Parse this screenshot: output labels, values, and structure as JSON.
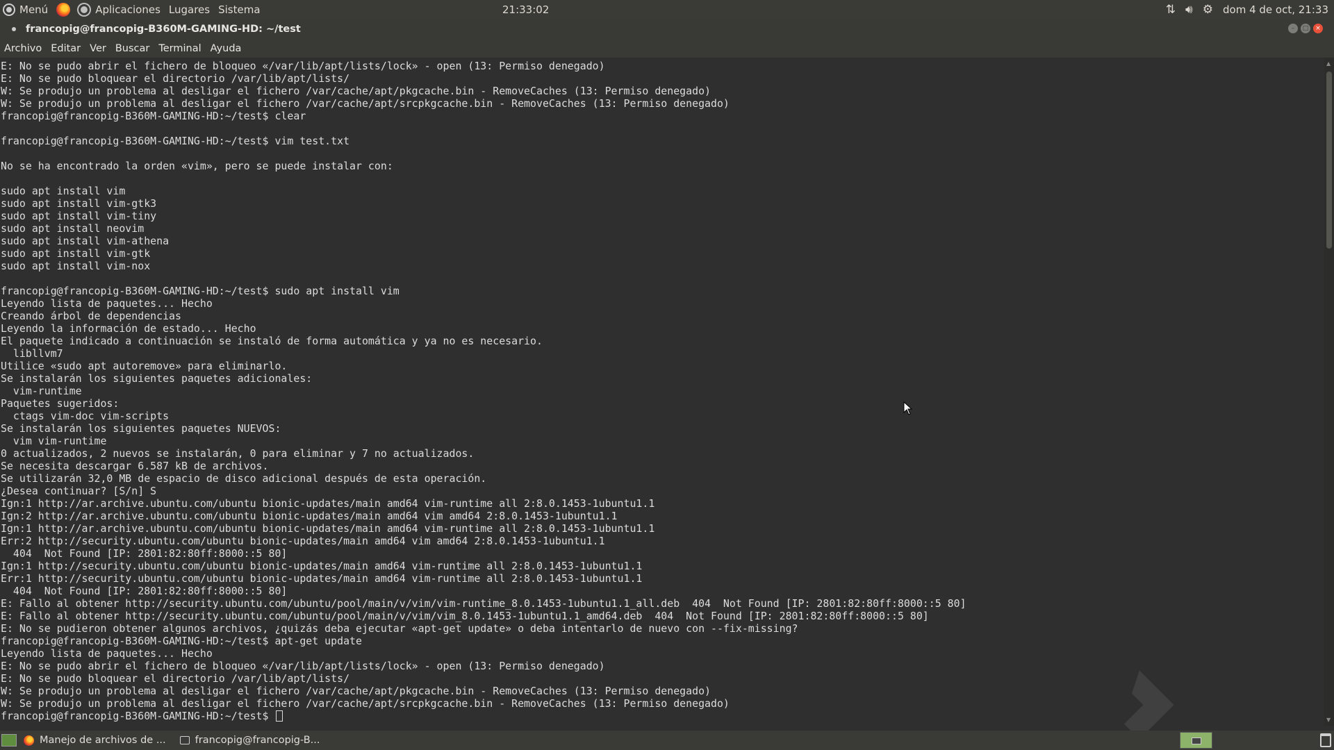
{
  "top_panel": {
    "menu_label": "Menú",
    "applications_label": "Aplicaciones",
    "places_label": "Lugares",
    "system_label": "Sistema",
    "clock": "21:33:02",
    "date": "dom  4 de oct, 21:33"
  },
  "window": {
    "title": "francopig@francopig-B360M-GAMING-HD: ~/test"
  },
  "menubar": {
    "file": "Archivo",
    "edit": "Editar",
    "view": "Ver",
    "search": "Buscar",
    "terminal": "Terminal",
    "help": "Ayuda"
  },
  "terminal": {
    "lines": [
      "E: No se pudo abrir el fichero de bloqueo «/var/lib/apt/lists/lock» - open (13: Permiso denegado)",
      "E: No se pudo bloquear el directorio /var/lib/apt/lists/",
      "W: Se produjo un problema al desligar el fichero /var/cache/apt/pkgcache.bin - RemoveCaches (13: Permiso denegado)",
      "W: Se produjo un problema al desligar el fichero /var/cache/apt/srcpkgcache.bin - RemoveCaches (13: Permiso denegado)",
      "francopig@francopig-B360M-GAMING-HD:~/test$ clear",
      "",
      "francopig@francopig-B360M-GAMING-HD:~/test$ vim test.txt",
      "",
      "No se ha encontrado la orden «vim», pero se puede instalar con:",
      "",
      "sudo apt install vim",
      "sudo apt install vim-gtk3",
      "sudo apt install vim-tiny",
      "sudo apt install neovim",
      "sudo apt install vim-athena",
      "sudo apt install vim-gtk",
      "sudo apt install vim-nox",
      "",
      "francopig@francopig-B360M-GAMING-HD:~/test$ sudo apt install vim",
      "Leyendo lista de paquetes... Hecho",
      "Creando árbol de dependencias",
      "Leyendo la información de estado... Hecho",
      "El paquete indicado a continuación se instaló de forma automática y ya no es necesario.",
      "  libllvm7",
      "Utilice «sudo apt autoremove» para eliminarlo.",
      "Se instalarán los siguientes paquetes adicionales:",
      "  vim-runtime",
      "Paquetes sugeridos:",
      "  ctags vim-doc vim-scripts",
      "Se instalarán los siguientes paquetes NUEVOS:",
      "  vim vim-runtime",
      "0 actualizados, 2 nuevos se instalarán, 0 para eliminar y 7 no actualizados.",
      "Se necesita descargar 6.587 kB de archivos.",
      "Se utilizarán 32,0 MB de espacio de disco adicional después de esta operación.",
      "¿Desea continuar? [S/n] S",
      "Ign:1 http://ar.archive.ubuntu.com/ubuntu bionic-updates/main amd64 vim-runtime all 2:8.0.1453-1ubuntu1.1",
      "Ign:2 http://ar.archive.ubuntu.com/ubuntu bionic-updates/main amd64 vim amd64 2:8.0.1453-1ubuntu1.1",
      "Ign:1 http://ar.archive.ubuntu.com/ubuntu bionic-updates/main amd64 vim-runtime all 2:8.0.1453-1ubuntu1.1",
      "Err:2 http://security.ubuntu.com/ubuntu bionic-updates/main amd64 vim amd64 2:8.0.1453-1ubuntu1.1",
      "  404  Not Found [IP: 2801:82:80ff:8000::5 80]",
      "Ign:1 http://security.ubuntu.com/ubuntu bionic-updates/main amd64 vim-runtime all 2:8.0.1453-1ubuntu1.1",
      "Err:1 http://security.ubuntu.com/ubuntu bionic-updates/main amd64 vim-runtime all 2:8.0.1453-1ubuntu1.1",
      "  404  Not Found [IP: 2801:82:80ff:8000::5 80]",
      "E: Fallo al obtener http://security.ubuntu.com/ubuntu/pool/main/v/vim/vim-runtime_8.0.1453-1ubuntu1.1_all.deb  404  Not Found [IP: 2801:82:80ff:8000::5 80]",
      "E: Fallo al obtener http://security.ubuntu.com/ubuntu/pool/main/v/vim/vim_8.0.1453-1ubuntu1.1_amd64.deb  404  Not Found [IP: 2801:82:80ff:8000::5 80]",
      "E: No se pudieron obtener algunos archivos, ¿quizás deba ejecutar «apt-get update» o deba intentarlo de nuevo con --fix-missing?",
      "francopig@francopig-B360M-GAMING-HD:~/test$ apt-get update",
      "Leyendo lista de paquetes... Hecho",
      "E: No se pudo abrir el fichero de bloqueo «/var/lib/apt/lists/lock» - open (13: Permiso denegado)",
      "E: No se pudo bloquear el directorio /var/lib/apt/lists/",
      "W: Se produjo un problema al desligar el fichero /var/cache/apt/pkgcache.bin - RemoveCaches (13: Permiso denegado)",
      "W: Se produjo un problema al desligar el fichero /var/cache/apt/srcpkgcache.bin - RemoveCaches (13: Permiso denegado)"
    ],
    "prompt": "francopig@francopig-B360M-GAMING-HD:~/test$ "
  },
  "taskbar": {
    "tasks": [
      {
        "label": "Manejo de archivos de ...",
        "icon": "firefox-icon"
      },
      {
        "label": "francopig@francopig-B...",
        "icon": "terminal-icon"
      }
    ]
  },
  "icons": {
    "menu": "menu-icon",
    "browser": "firefox-icon",
    "applications": "applications-icon",
    "network": "network-icon",
    "volume": "volume-icon",
    "settings": "gear-icon",
    "trash": "trash-icon"
  }
}
